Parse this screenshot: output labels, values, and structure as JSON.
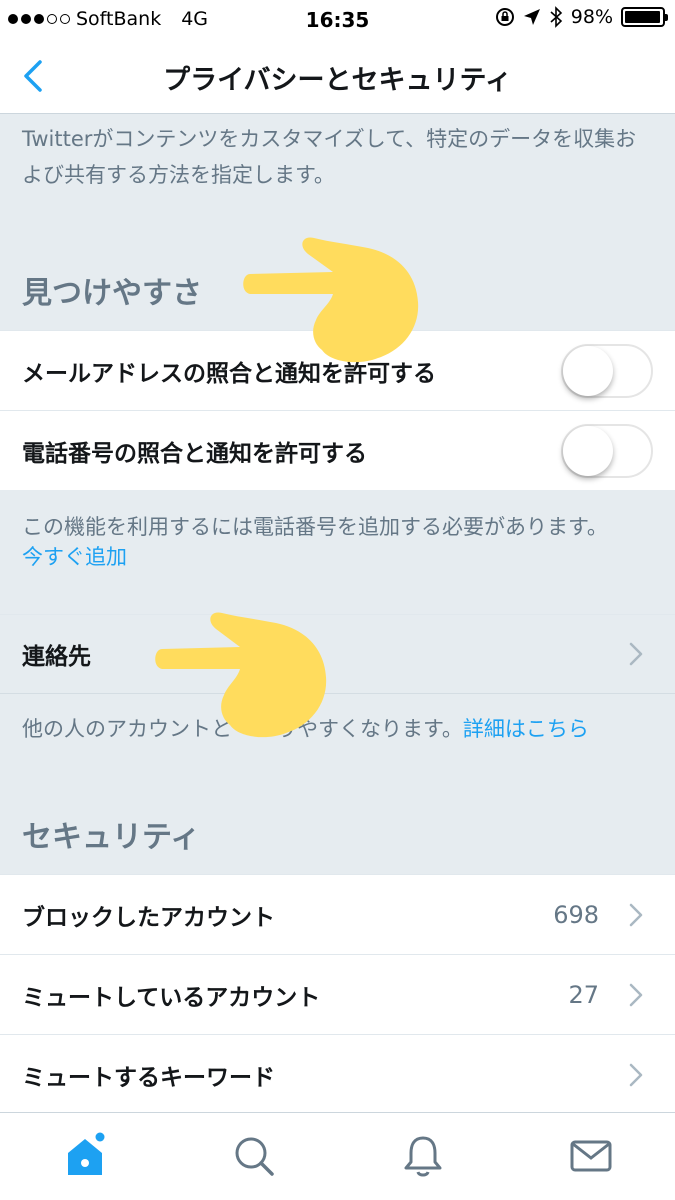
{
  "status_bar": {
    "carrier": "SoftBank",
    "network": "4G",
    "time": "16:35",
    "battery": "98%",
    "battery_level": 0.98
  },
  "nav": {
    "title": "プライバシーとセキュリティ"
  },
  "intro_text": "Twitterがコンテンツをカスタマイズして、特定のデータを収集および共有する方法を指定します。",
  "discoverability": {
    "header": "見つけやすさ",
    "email_toggle_label": "メールアドレスの照合と通知を許可する",
    "email_toggle_on": false,
    "phone_toggle_label": "電話番号の照合と通知を許可する",
    "phone_toggle_on": false,
    "phone_note": "この機能を利用するには電話番号を追加する必要があります。",
    "phone_note_link": "今すぐ追加",
    "contacts_label": "連絡先",
    "contacts_note": "他の人のアカウントと",
    "contacts_note_tail": "りやすくなります。",
    "contacts_note_link": "詳細はこちら"
  },
  "security": {
    "header": "セキュリティ",
    "blocked_label": "ブロックしたアカウント",
    "blocked_count": "698",
    "muted_label": "ミュートしているアカウント",
    "muted_count": "27",
    "muted_keywords_label": "ミュートするキーワード"
  },
  "tabs": {
    "items": [
      "home-icon",
      "search-icon",
      "bell-icon",
      "mail-icon"
    ],
    "active_color": "#1da1f2",
    "inactive_color": "#657786"
  },
  "colors": {
    "accent": "#1da1f2",
    "background": "#e6ecf0",
    "finger": "#ffdc5d"
  }
}
